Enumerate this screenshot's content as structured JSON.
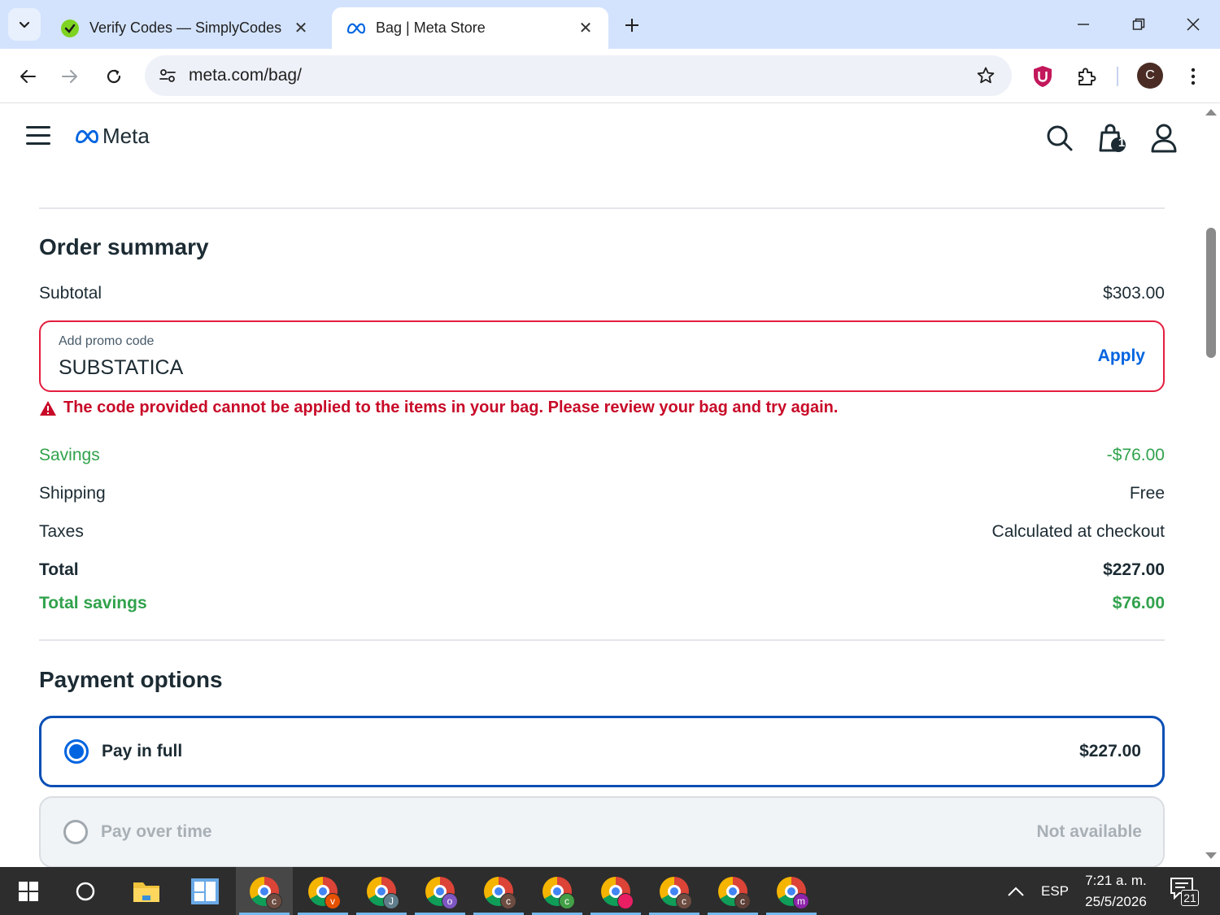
{
  "browser": {
    "tabs": [
      {
        "title": "Verify Codes — SimplyCodes",
        "active": false,
        "favicon": "simplycodes-icon"
      },
      {
        "title": "Bag | Meta Store",
        "active": true,
        "favicon": "meta-icon"
      }
    ],
    "url": "meta.com/bag/",
    "profile_initial": "C"
  },
  "header": {
    "logo_text": "Meta",
    "bag_count": "1"
  },
  "order_summary": {
    "title": "Order summary",
    "subtotal_label": "Subtotal",
    "subtotal_value": "$303.00",
    "promo": {
      "label": "Add promo code",
      "value": "SUBSTATICA",
      "apply_label": "Apply",
      "error": "The code provided cannot be applied to the items in your bag. Please review your bag and try again."
    },
    "savings_label": "Savings",
    "savings_value": "-$76.00",
    "shipping_label": "Shipping",
    "shipping_value": "Free",
    "taxes_label": "Taxes",
    "taxes_value": "Calculated at checkout",
    "total_label": "Total",
    "total_value": "$227.00",
    "total_savings_label": "Total savings",
    "total_savings_value": "$76.00"
  },
  "payment_options": {
    "title": "Payment options",
    "options": [
      {
        "label": "Pay in full",
        "value": "$227.00",
        "selected": true,
        "disabled": false
      },
      {
        "label": "Pay over time",
        "value": "Not available",
        "selected": false,
        "disabled": true
      }
    ]
  },
  "taskbar": {
    "apps": [
      {
        "name": "chrome",
        "badge": "c",
        "badge_color": "#6d4c41"
      },
      {
        "name": "chrome",
        "badge": "v",
        "badge_color": "#e65100"
      },
      {
        "name": "chrome",
        "badge": "J",
        "badge_color": "#607d8b"
      },
      {
        "name": "chrome",
        "badge": "o",
        "badge_color": "#7e57c2"
      },
      {
        "name": "chrome",
        "badge": "c",
        "badge_color": "#6d4c41"
      },
      {
        "name": "chrome",
        "badge": "c",
        "badge_color": "#43a047"
      },
      {
        "name": "chrome",
        "badge": "",
        "badge_color": "#e91e63"
      },
      {
        "name": "chrome",
        "badge": "c",
        "badge_color": "#6d4c41"
      },
      {
        "name": "chrome",
        "badge": "c",
        "badge_color": "#5d4037"
      },
      {
        "name": "chrome",
        "badge": "m",
        "badge_color": "#8e24aa"
      }
    ],
    "language": "ESP",
    "time": "7:21 a. m.",
    "date": "25/5/2026",
    "notifications": "21"
  },
  "colors": {
    "accent": "#0064e0",
    "error": "#e41e3f",
    "savings": "#31a24c",
    "tabstrip": "#d3e3fd"
  }
}
